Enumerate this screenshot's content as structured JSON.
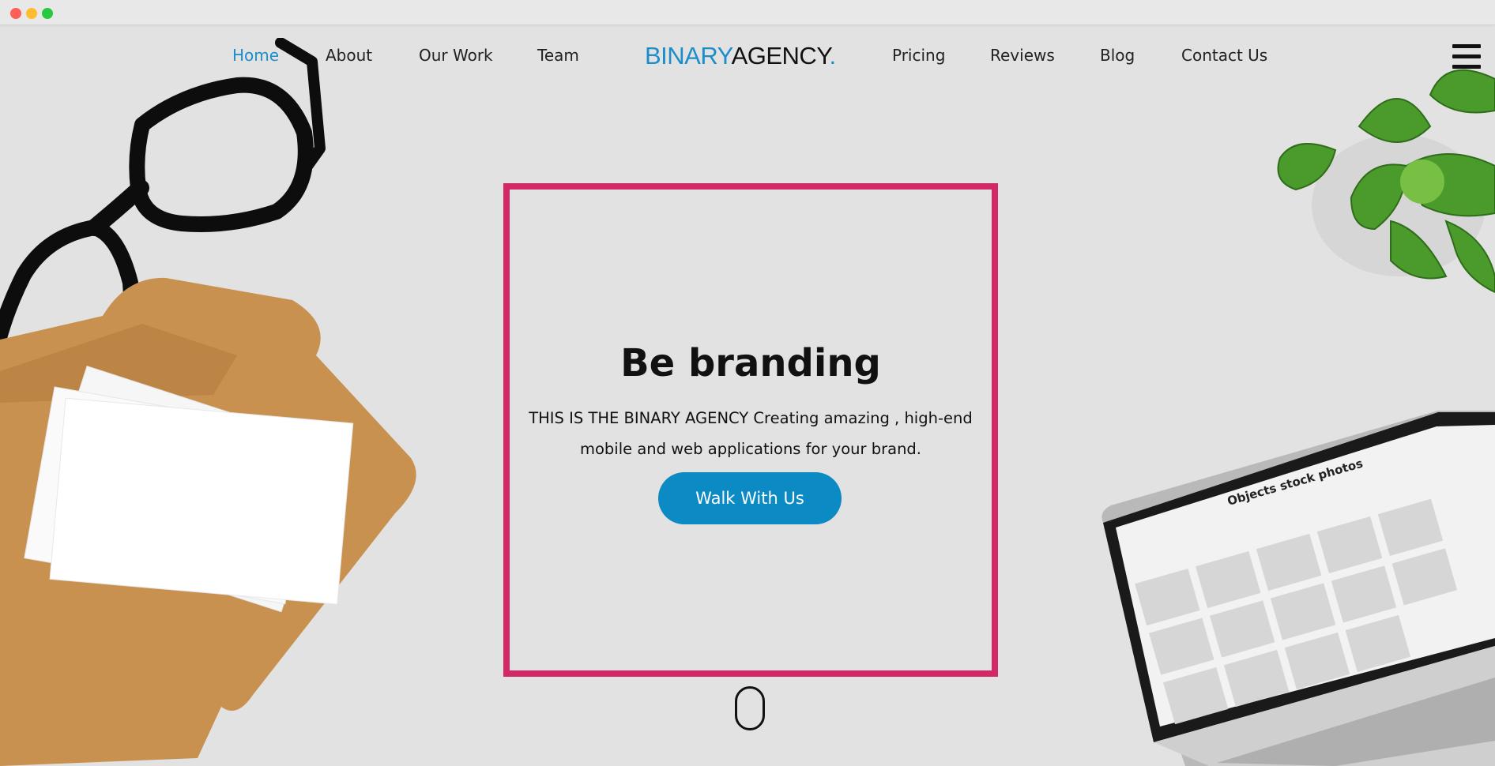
{
  "window": {
    "controls": [
      "close",
      "minimize",
      "maximize"
    ]
  },
  "nav": {
    "left": [
      "Home",
      "About",
      "Our Work",
      "Team"
    ],
    "right": [
      "Pricing",
      "Reviews",
      "Blog",
      "Contact Us"
    ],
    "active": "Home",
    "menu_icon": "hamburger-menu-icon"
  },
  "logo": {
    "part1": "BINARY",
    "part2": "AGENCY",
    "dot": "."
  },
  "hero": {
    "title": "Be branding",
    "text": "THIS IS THE BINARY AGENCY Creating amazing , high-end mobile and web applications for your brand.",
    "cta": "Walk With Us"
  },
  "laptop_screen": {
    "title": "Objects stock photos"
  },
  "colors": {
    "accent": "#1b8ec9",
    "frame": "#d22866",
    "button": "#0b8ac4",
    "background": "#e2e2e2"
  },
  "decor": [
    "eyeglasses",
    "envelope-with-cards",
    "succulent-plant",
    "laptop"
  ]
}
